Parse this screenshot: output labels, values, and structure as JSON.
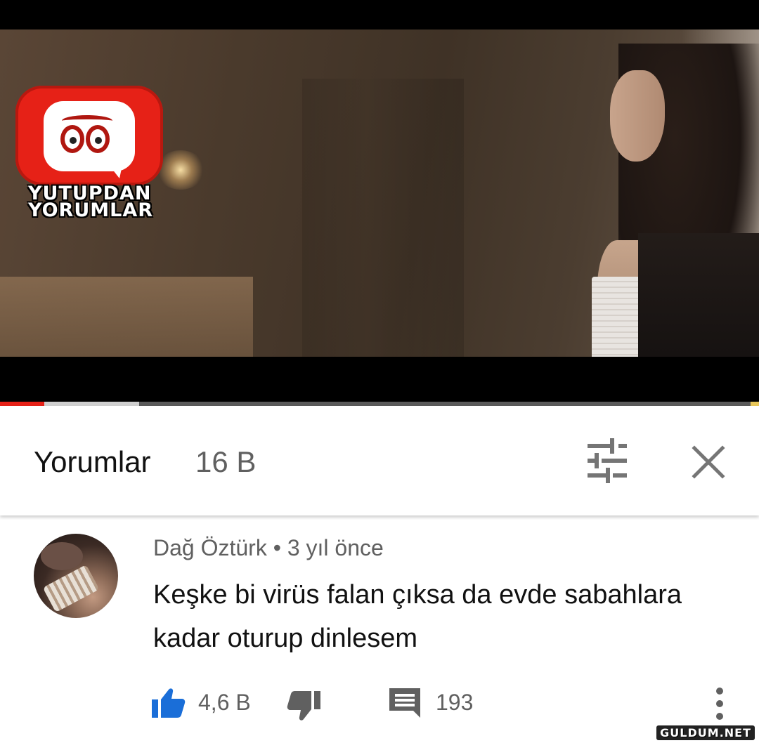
{
  "video": {
    "logo_line1": "YUTUPDAN",
    "logo_line2": "YORUMLAR",
    "progress_played_fraction": 0.058,
    "progress_buffered_fraction": 0.183,
    "colors": {
      "progress_played": "#e62117",
      "logo_red": "#e62117"
    }
  },
  "header": {
    "title": "Yorumlar",
    "count": "16 B",
    "sort_icon": "sort-filter-icon",
    "close_icon": "close-icon"
  },
  "comment": {
    "author": "Dağ Öztürk",
    "separator": "•",
    "time": "3 yıl önce",
    "text": "Keşke bi virüs falan çıksa da evde sabahlara kadar oturup dinlesem",
    "likes": "4,6 B",
    "replies": "193",
    "colors": {
      "like_active": "#1a6ed8",
      "icon_gray": "#606060"
    }
  },
  "watermark": "GULDUM.NET"
}
